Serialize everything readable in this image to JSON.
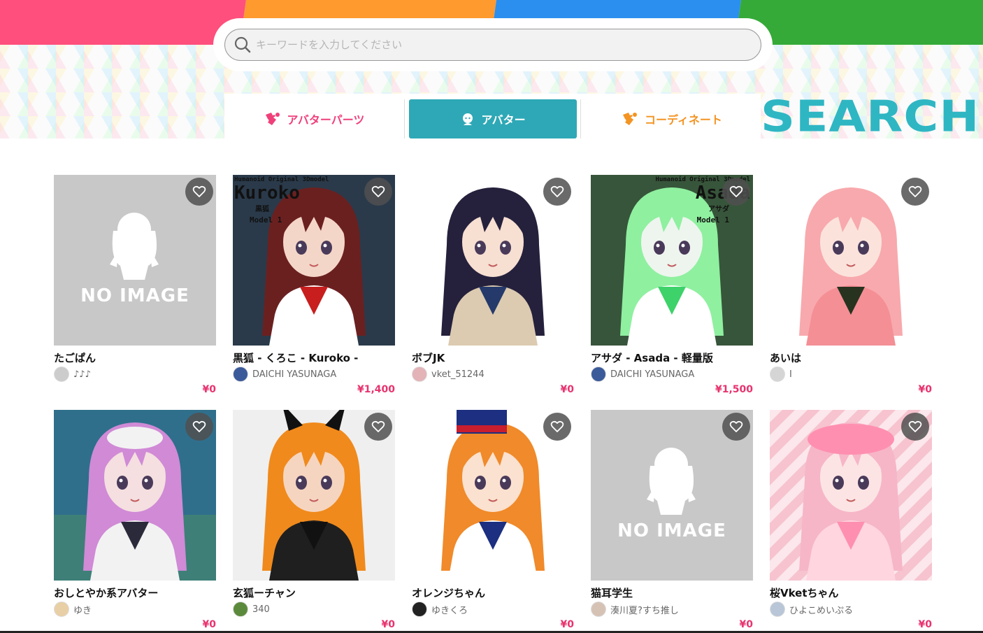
{
  "search": {
    "placeholder": "キーワードを入力してください"
  },
  "tabs": [
    {
      "label": "アバターパーツ",
      "icon": "puzzle-icon",
      "color": "#f0407a"
    },
    {
      "label": "アバター",
      "icon": "avatar-icon",
      "active": true,
      "color": "#2ea8b6"
    },
    {
      "label": "コーディネート",
      "icon": "puzzle-icon",
      "color": "#f39423"
    }
  ],
  "banner": {
    "title": "SEARCH"
  },
  "colors": {
    "band1": "#ff4f7c",
    "band2": "#ff9a2e",
    "band3": "#2b8ff0",
    "band4": "#35aa38",
    "price": "#e8336e",
    "accent": "#2ea8b6"
  },
  "products": [
    {
      "title": "たごぱん",
      "author": "♪♪♪",
      "price": "¥0",
      "image": "no-image",
      "no_image_label": "NO IMAGE"
    },
    {
      "title": "黒狐 - くろこ - Kuroko -",
      "author": "DAICHI YASUNAGA",
      "price": "¥1,400",
      "image": "fox-shrine-maiden",
      "overlay": {
        "l1": "Humanoid Original 3Dmodel",
        "l2": "Kuroko",
        "l3": "黒狐",
        "l4": "Model 1"
      }
    },
    {
      "title": "ボブJK",
      "author": "vket_51244",
      "price": "¥0",
      "image": "bob-schoolgirl"
    },
    {
      "title": "アサダ - Asada - 軽量版",
      "author": "DAICHI YASUNAGA",
      "price": "¥1,500",
      "image": "green-android",
      "overlay": {
        "l1": "Humanoid Original 3Dmodel",
        "l2": "Asada",
        "l3": "アサダ",
        "l4": "Model 1"
      }
    },
    {
      "title": "あいは",
      "author": "I",
      "price": "¥0",
      "image": "pink-hair-girl"
    },
    {
      "title": "おしとやか系アバター",
      "author": "ゆき",
      "price": "¥0",
      "image": "purple-hair-city"
    },
    {
      "title": "玄狐ーチャン",
      "author": "340",
      "price": "¥0",
      "image": "black-fox-orange-hair"
    },
    {
      "title": "オレンジちゃん",
      "author": "ゆきくろ",
      "price": "¥0",
      "image": "orange-hair-hat"
    },
    {
      "title": "猫耳学生",
      "author": "湊川夏?すち推し",
      "price": "¥0",
      "image": "no-image",
      "no_image_label": "NO IMAGE"
    },
    {
      "title": "桜Vketちゃん",
      "author": "ひよこめいぷる",
      "price": "¥0",
      "image": "pink-beret-girl"
    }
  ]
}
